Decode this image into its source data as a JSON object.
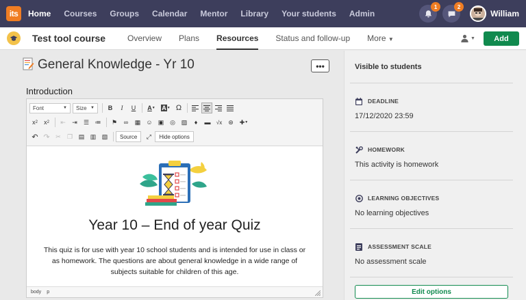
{
  "nav": {
    "logo": "its",
    "items": [
      {
        "label": "Home",
        "active": true
      },
      {
        "label": "Courses",
        "active": false
      },
      {
        "label": "Groups",
        "active": false
      },
      {
        "label": "Calendar",
        "active": false
      },
      {
        "label": "Mentor",
        "active": false
      },
      {
        "label": "Library",
        "active": false
      },
      {
        "label": "Your students",
        "active": false
      },
      {
        "label": "Admin",
        "active": false
      }
    ],
    "notifications_count": "1",
    "messages_count": "2",
    "user_name": "William"
  },
  "subnav": {
    "course_title": "Test tool course",
    "tabs": [
      "Overview",
      "Plans",
      "Resources",
      "Status and follow-up",
      "More"
    ],
    "active_tab": "Resources",
    "add_label": "Add"
  },
  "page": {
    "title": "General Knowledge - Yr 10",
    "more_label": "•••",
    "intro_label": "Introduction"
  },
  "editor": {
    "font_select": "Font",
    "size_select": "Size",
    "source_label": "Source",
    "hide_options_label": "Hide options",
    "quiz_title": "Year 10 – End of year Quiz",
    "quiz_description": "This quiz is for use with year 10 school students and is intended for use in class or as homework. The questions are about general knowledge in a wide range of subjects suitable for children of this age.",
    "path": [
      "body",
      "p"
    ]
  },
  "side": {
    "visibility": "Visible to students",
    "sections": [
      {
        "icon": "calendar-icon",
        "heading": "DEADLINE",
        "value": "17/12/2020 23:59"
      },
      {
        "icon": "homework-tools-icon",
        "heading": "HOMEWORK",
        "value": "This activity is homework"
      },
      {
        "icon": "target-icon",
        "heading": "LEARNING OBJECTIVES",
        "value": "No learning objectives"
      },
      {
        "icon": "assessment-scale-icon",
        "heading": "ASSESSMENT SCALE",
        "value": "No assessment scale"
      }
    ],
    "edit_options_label": "Edit options"
  },
  "colors": {
    "nav_bg": "#3d3e5c",
    "accent_orange": "#f07d23",
    "primary_green": "#108a4e"
  }
}
